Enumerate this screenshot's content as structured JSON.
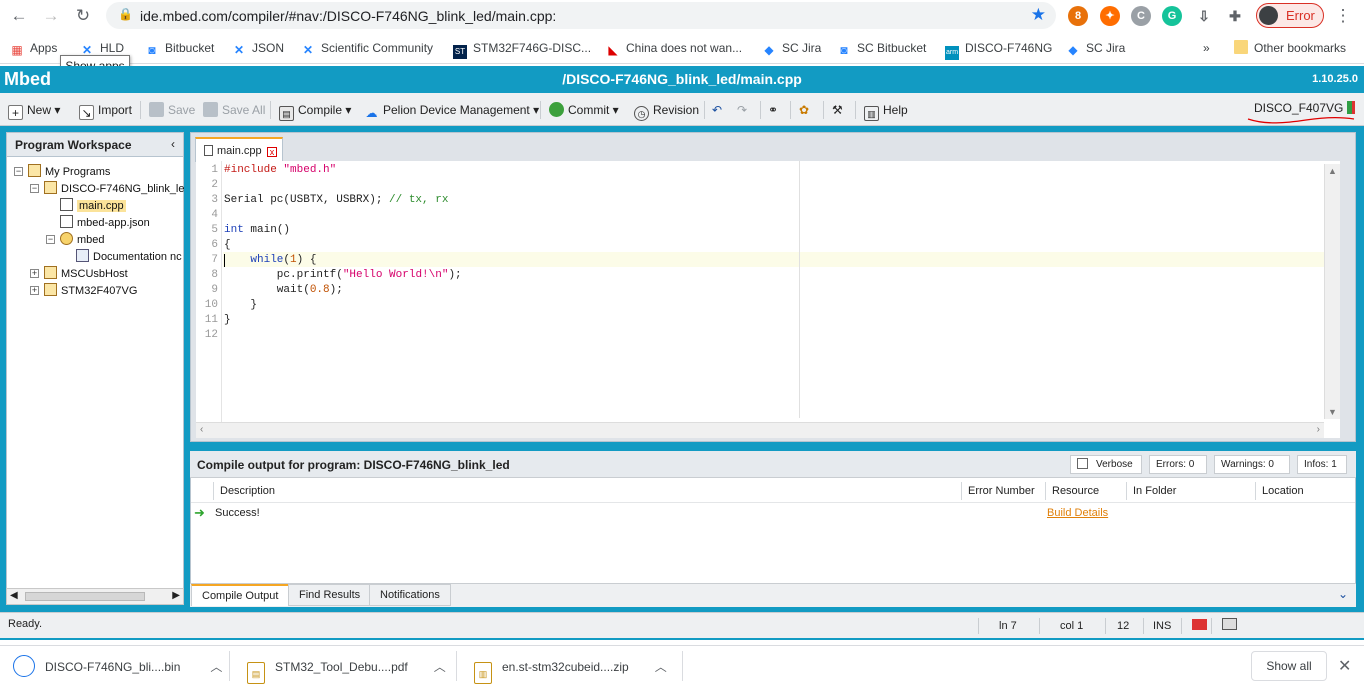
{
  "browser": {
    "url": "ide.mbed.com/compiler/#nav:/DISCO-F746NG_blink_led/main.cpp:",
    "error_label": "Error",
    "ext_badge": "8",
    "bookmarks": [
      "Apps",
      "HLD",
      "Bitbucket",
      "JSON",
      "Scientific Community",
      "STM32F746G-DISC...",
      "China does not wan...",
      "SC Jira",
      "SC Bitbucket",
      "DISCO-F746NG",
      "SC Jira"
    ],
    "more": "»",
    "other_bookmarks": "Other bookmarks",
    "tooltip": "Show apps"
  },
  "header": {
    "logo": "Mbed",
    "path": "/DISCO-F746NG_blink_led/main.cpp",
    "version": "1.10.25.0"
  },
  "toolbar": {
    "new": "New",
    "import": "Import",
    "save": "Save",
    "save_all": "Save All",
    "compile": "Compile",
    "pelion": "Pelion Device Management",
    "commit": "Commit",
    "revision": "Revision",
    "help": "Help",
    "target": "DISCO_F407VG"
  },
  "workspace": {
    "title": "Program Workspace",
    "tree": [
      "My Programs",
      "DISCO-F746NG_blink_le",
      "main.cpp",
      "mbed-app.json",
      "mbed",
      "Documentation nc",
      "MSCUsbHost",
      "STM32F407VG"
    ]
  },
  "editor": {
    "tab": "main.cpp",
    "line_numbers": [
      "1",
      "2",
      "3",
      "4",
      "5",
      "6",
      "7",
      "8",
      "9",
      "10",
      "11",
      "12"
    ]
  },
  "output": {
    "title": "Compile output for program: DISCO-F746NG_blink_led",
    "verbose": "Verbose",
    "errors": "Errors: 0",
    "warnings": "Warnings: 0",
    "infos": "Infos: 1",
    "columns": [
      "Description",
      "Error Number",
      "Resource",
      "In Folder",
      "Location"
    ],
    "row": {
      "description": "Success!",
      "resource": "Build Details"
    },
    "tabs": [
      "Compile Output",
      "Find Results",
      "Notifications"
    ]
  },
  "status": {
    "text": "Ready.",
    "ln": "ln 7",
    "col": "col 1",
    "num": "12",
    "mode": "INS"
  },
  "downloads": {
    "items": [
      "DISCO-F746NG_bli....bin",
      "STM32_Tool_Debu....pdf",
      "en.st-stm32cubeid....zip"
    ],
    "show_all": "Show all"
  },
  "colors": {
    "accent": "#129bc3",
    "tab_highlight": "#f5a623"
  }
}
